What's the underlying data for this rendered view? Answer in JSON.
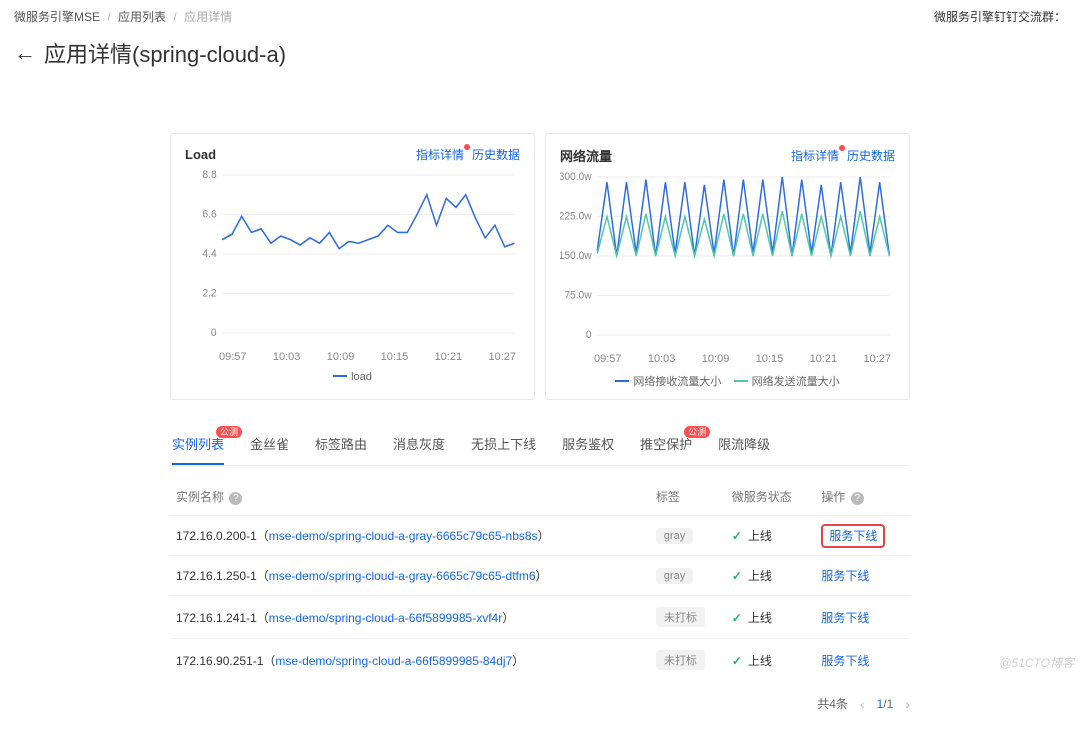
{
  "breadcrumb": {
    "items": [
      "微服务引擎MSE",
      "应用列表",
      "应用详情"
    ],
    "right": "微服务引擎钉钉交流群："
  },
  "title": {
    "back_icon": "←",
    "text": "应用详情(spring-cloud-a)"
  },
  "cards": {
    "load": {
      "title": "Load",
      "link_detail": "指标详情",
      "link_history": "历史数据",
      "legend": "load"
    },
    "net": {
      "title": "网络流量",
      "link_detail": "指标详情",
      "link_history": "历史数据",
      "legend_rx": "网络接收流量大小",
      "legend_tx": "网络发送流量大小"
    }
  },
  "chart_data": [
    {
      "id": "load",
      "type": "line",
      "title": "Load",
      "ylabel": "",
      "ylim": [
        0,
        8.8
      ],
      "yticks": [
        0,
        2.2,
        4.4,
        6.6,
        8.8
      ],
      "x": [
        "09:57",
        "10:03",
        "10:09",
        "10:15",
        "10:21",
        "10:27"
      ],
      "series": [
        {
          "name": "load",
          "color": "#2e6be6",
          "values": [
            5.2,
            5.5,
            6.5,
            5.6,
            5.8,
            5.0,
            5.4,
            5.2,
            4.9,
            5.3,
            5.0,
            5.6,
            4.7,
            5.1,
            5.0,
            5.2,
            5.4,
            6.0,
            5.6,
            5.6,
            6.6,
            7.7,
            6.0,
            7.5,
            7.0,
            7.7,
            6.4,
            5.3,
            6.0,
            4.8,
            5.0
          ]
        }
      ]
    },
    {
      "id": "net",
      "type": "line",
      "title": "网络流量",
      "ylabel": "",
      "ylim": [
        0,
        300
      ],
      "yticks_labels": [
        "0",
        "75.0w",
        "150.0w",
        "225.0w",
        "300.0w"
      ],
      "yticks": [
        0,
        75,
        150,
        225,
        300
      ],
      "x": [
        "09:57",
        "10:03",
        "10:09",
        "10:15",
        "10:21",
        "10:27"
      ],
      "series": [
        {
          "name": "网络接收流量大小",
          "color": "#2e6be6",
          "values": [
            160,
            290,
            150,
            290,
            155,
            295,
            150,
            290,
            155,
            290,
            150,
            285,
            155,
            295,
            150,
            295,
            155,
            295,
            155,
            300,
            150,
            295,
            155,
            285,
            150,
            290,
            155,
            300,
            155,
            290,
            150
          ]
        },
        {
          "name": "网络发送流量大小",
          "color": "#4fc9a8",
          "values": [
            155,
            225,
            150,
            225,
            150,
            230,
            150,
            225,
            150,
            225,
            150,
            220,
            150,
            230,
            150,
            230,
            150,
            230,
            150,
            235,
            150,
            230,
            150,
            225,
            150,
            225,
            150,
            235,
            150,
            225,
            150
          ]
        }
      ]
    }
  ],
  "tabs": {
    "items": [
      {
        "label": "实例列表",
        "badge": "公测",
        "active": true
      },
      {
        "label": "金丝雀"
      },
      {
        "label": "标签路由"
      },
      {
        "label": "消息灰度"
      },
      {
        "label": "无损上下线"
      },
      {
        "label": "服务鉴权"
      },
      {
        "label": "推空保护",
        "badge": "公测"
      },
      {
        "label": "限流降级"
      }
    ]
  },
  "table": {
    "columns": {
      "name": "实例名称",
      "tag": "标签",
      "status": "微服务状态",
      "action": "操作"
    },
    "rows": [
      {
        "ip": "172.16.0.200-1",
        "pod": "mse-demo/spring-cloud-a-gray-6665c79c65-nbs8s",
        "tag": "gray",
        "status": "上线",
        "action": "服务下线",
        "hot": true
      },
      {
        "ip": "172.16.1.250-1",
        "pod": "mse-demo/spring-cloud-a-gray-6665c79c65-dtfm6",
        "tag": "gray",
        "status": "上线",
        "action": "服务下线",
        "hot": false
      },
      {
        "ip": "172.16.1.241-1",
        "pod": "mse-demo/spring-cloud-a-66f5899985-xvf4r",
        "tag": "未打标",
        "status": "上线",
        "action": "服务下线",
        "hot": false
      },
      {
        "ip": "172.16.90.251-1",
        "pod": "mse-demo/spring-cloud-a-66f5899985-84dj7",
        "tag": "未打标",
        "status": "上线",
        "action": "服务下线",
        "hot": false
      }
    ]
  },
  "pagination": {
    "total": "共4条",
    "current": "1",
    "total_pages": "1"
  },
  "watermark": "@51CTO博客"
}
